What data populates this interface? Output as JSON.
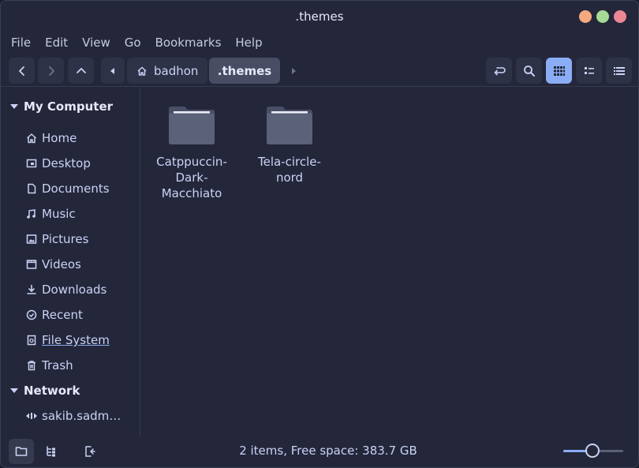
{
  "window": {
    "title": ".themes"
  },
  "menu": [
    "File",
    "Edit",
    "View",
    "Go",
    "Bookmarks",
    "Help"
  ],
  "toolbar": {
    "breadcrumb_home": "badhon",
    "breadcrumb_current": ".themes"
  },
  "sidebar": {
    "sections": [
      {
        "title": "My Computer",
        "items": [
          {
            "label": "Home",
            "icon": "home-icon"
          },
          {
            "label": "Desktop",
            "icon": "desktop-icon"
          },
          {
            "label": "Documents",
            "icon": "document-icon"
          },
          {
            "label": "Music",
            "icon": "music-icon"
          },
          {
            "label": "Pictures",
            "icon": "picture-icon"
          },
          {
            "label": "Videos",
            "icon": "video-icon"
          },
          {
            "label": "Downloads",
            "icon": "download-icon"
          },
          {
            "label": "Recent",
            "icon": "recent-icon"
          },
          {
            "label": "File System",
            "icon": "drive-icon"
          },
          {
            "label": "Trash",
            "icon": "trash-icon"
          }
        ]
      },
      {
        "title": "Network",
        "items": [
          {
            "label": "sakib.sadm…",
            "icon": "network-share-icon"
          }
        ]
      }
    ]
  },
  "files": [
    {
      "name": "Catppuccin-\nDark-\nMacchiato",
      "lines": [
        "Catppuccin-",
        "Dark-",
        "Macchiato"
      ]
    },
    {
      "name": "Tela-circle-\nnord",
      "lines": [
        "Tela-circle-",
        "nord"
      ]
    }
  ],
  "status": {
    "text": "2 items, Free space: 383.7 GB",
    "zoom_fraction": 0.49
  },
  "colors": {
    "accent": "#8aadf4",
    "background": "#24273a",
    "surface": "#2e3247",
    "folder": "#5b6178"
  }
}
